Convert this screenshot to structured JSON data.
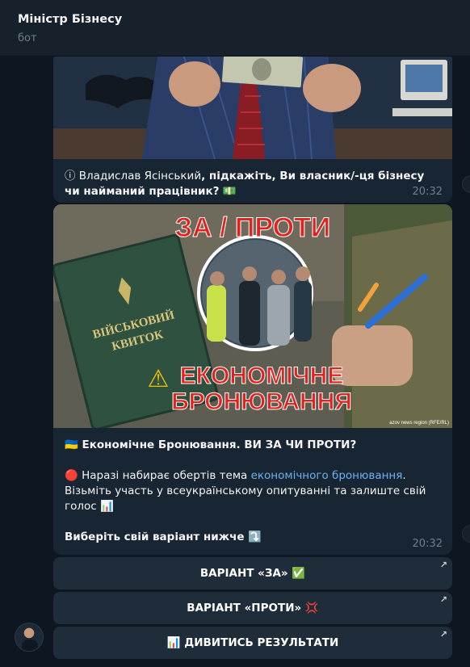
{
  "header": {
    "title": "Міністр Бізнесу",
    "status": "бот"
  },
  "message1": {
    "info_icon": "ⓘ",
    "prefix": " Владислав Ясінський",
    "bold": ", підкажіть, Ви власник/-ця бізнесу чи найманий працівник?",
    "money_icon": "💵",
    "time": "20:32"
  },
  "message2": {
    "image_texts": {
      "top_banner": "ЗА / ПРОТИ",
      "ticket_line1": "ВІЙСЬКОВИЙ",
      "ticket_line2": "КВИТОК",
      "warning": "⚠",
      "headline1": "ЕКОНОМІЧНЕ",
      "headline2": "БРОНЮВАННЯ",
      "credit": "azov news region (RFE/RL)"
    },
    "title_flag": "🇺🇦",
    "title": " Економічне Бронювання. ВИ ЗА ЧИ ПРОТИ?",
    "p1_icon": "🔴",
    "p1_start": " Наразі набирає обертів тема ",
    "p1_link": "економічного бронювання",
    "p1_end": ". Візьміть участь у всеукраїнському опитуванні та залиште свій голос ",
    "p1_chart_icon": "📊",
    "p2": "Виберіть свій варіант нижче ",
    "p2_icon": "⤵️",
    "time": "20:32"
  },
  "buttons": [
    {
      "label": "ВАРІАНТ «ЗА» ✅",
      "arrow": "↗"
    },
    {
      "label": "ВАРІАНТ «ПРОТИ» 💢",
      "arrow": "↗"
    },
    {
      "label": "📊 ДИВИТИСЬ РЕЗУЛЬТАТИ",
      "arrow": "↗"
    }
  ],
  "icons": {
    "avatar": "bot-avatar-icon",
    "external_link": "arrow-up-right-icon",
    "scroll": "scroll-side-icon"
  },
  "colors": {
    "background": "#0e1621",
    "header": "#17212b",
    "bubble": "#182533",
    "button": "#1f2c39",
    "link": "#6ab3f3",
    "muted": "#6d7f8f",
    "headline_red": "#e0231c"
  }
}
